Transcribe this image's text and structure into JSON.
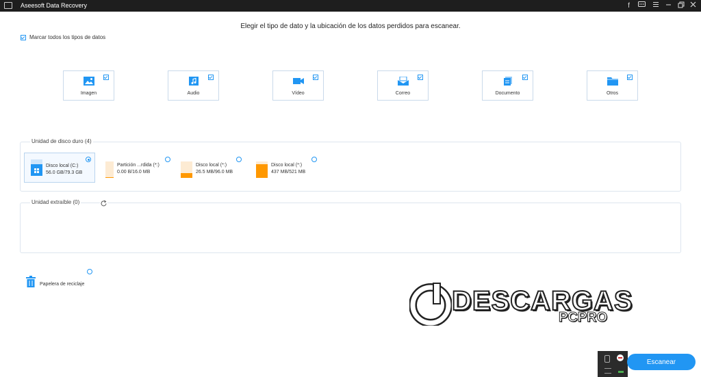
{
  "window": {
    "title": "Aseesoft Data Recovery",
    "controls": [
      "facebook-icon",
      "chat-icon",
      "menu-icon",
      "minimize-icon",
      "restore-icon",
      "close-icon"
    ]
  },
  "heading": "Elegir el tipo de dato y la ubicación de los datos perdidos para escanear.",
  "mark_all": {
    "label": "Marcar todos los tipos de datos",
    "checked": true
  },
  "data_types": [
    {
      "label": "Imagen",
      "icon": "image-icon",
      "checked": true
    },
    {
      "label": "Audio",
      "icon": "music-icon",
      "checked": true
    },
    {
      "label": "Vídeo",
      "icon": "video-icon",
      "checked": true
    },
    {
      "label": "Correo",
      "icon": "mail-icon",
      "checked": true
    },
    {
      "label": "Documento",
      "icon": "document-icon",
      "checked": true
    },
    {
      "label": "Otros",
      "icon": "folder-icon",
      "checked": true
    }
  ],
  "hard_drives": {
    "title": "Unidad de disco duro (4)",
    "items": [
      {
        "name": "Disco local (C:)",
        "size": "56.0 GB/79.3 GB",
        "selected": true,
        "fill": 0.71,
        "icon": "windows-drive-icon"
      },
      {
        "name": "Partición ...rdida (*:)",
        "size": "0.00  B/16.0 MB",
        "selected": false,
        "fill": 0.0,
        "icon": "drive-icon"
      },
      {
        "name": "Disco local (*:)",
        "size": "26.5 MB/96.0 MB",
        "selected": false,
        "fill": 0.28,
        "icon": "drive-icon"
      },
      {
        "name": "Disco local (*:)",
        "size": "437 MB/521 MB",
        "selected": false,
        "fill": 0.84,
        "icon": "drive-icon"
      }
    ]
  },
  "removable": {
    "title": "Unidad extraíble (0)",
    "refresh_icon": "refresh-icon"
  },
  "recycle_bin": {
    "label": "Papelera de reciclaje",
    "icon": "trash-icon",
    "selected": false
  },
  "scan_button": "Escanear",
  "watermark": {
    "line1": "DESCARGAS",
    "line2": "PCPRO"
  },
  "colors": {
    "accent": "#2196f3",
    "drive_full": "#ff9800",
    "drive_empty": "#fdebd3",
    "titlebar": "#1e1e1e"
  }
}
